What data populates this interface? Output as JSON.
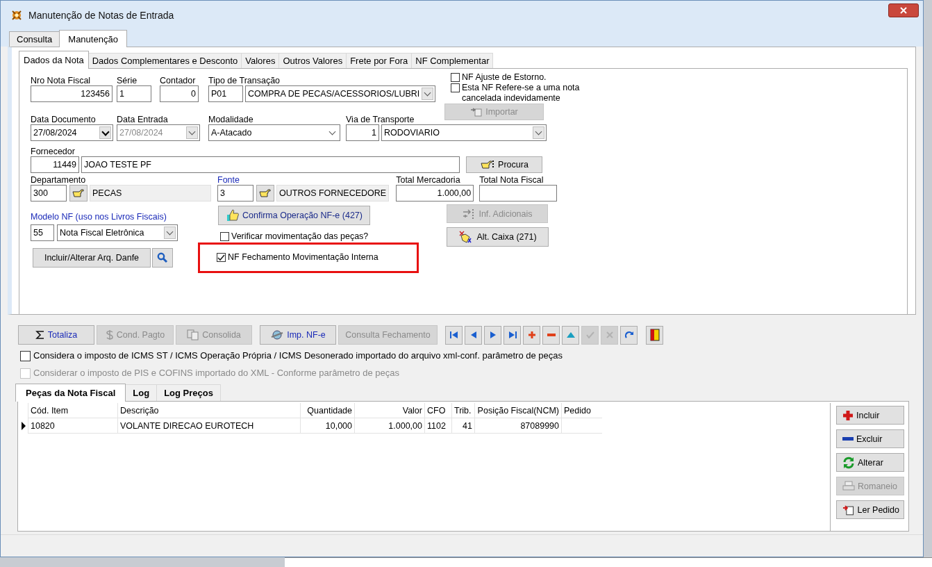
{
  "window": {
    "title": "Manutenção de Notas de Entrada"
  },
  "main_tabs": [
    {
      "label": "Consulta",
      "selected": false
    },
    {
      "label": "Manutenção",
      "selected": true
    }
  ],
  "sub_tabs": [
    {
      "label": "Dados da Nota",
      "selected": true
    },
    {
      "label": "Dados Complementares e Desconto",
      "selected": false
    },
    {
      "label": "Valores",
      "selected": false
    },
    {
      "label": "Outros Valores",
      "selected": false
    },
    {
      "label": "Frete por Fora",
      "selected": false
    },
    {
      "label": "NF Complementar",
      "selected": false
    }
  ],
  "form": {
    "nro_nota_fiscal": {
      "label": "Nro Nota Fiscal",
      "value": "123456"
    },
    "serie": {
      "label": "Série",
      "value": "1"
    },
    "contador": {
      "label": "Contador",
      "value": "0"
    },
    "tipo_transacao": {
      "label": "Tipo de Transação",
      "code": "P01",
      "value": "COMPRA DE PECAS/ACESSORIOS/LUBRI"
    },
    "nf_ajuste": {
      "label": "NF Ajuste  de Estorno.",
      "checked": false
    },
    "nf_refere": {
      "label": "Esta NF Refere-se a uma nota cancelada indevidamente",
      "checked": false
    },
    "importar": {
      "label": "Importar",
      "disabled": true
    },
    "data_documento": {
      "label": "Data Documento",
      "value": "27/08/2024",
      "disabled": false
    },
    "data_entrada": {
      "label": "Data Entrada",
      "value": "27/08/2024",
      "disabled": true
    },
    "modalidade": {
      "label": "Modalidade",
      "value": "A-Atacado"
    },
    "via_transporte": {
      "label": "Via de Transporte",
      "code": "1",
      "value": "RODOVIARIO"
    },
    "fornecedor": {
      "label": "Fornecedor",
      "code": "11449",
      "value": "JOAO TESTE PF"
    },
    "procura": {
      "label": "Procura"
    },
    "departamento": {
      "label": "Departamento",
      "code": "300",
      "value": "PECAS"
    },
    "fonte": {
      "label": "Fonte",
      "code": "3",
      "value": "OUTROS FORNECEDORE"
    },
    "total_mercadoria": {
      "label": "Total Mercadoria",
      "value": "1.000,00"
    },
    "total_nota_fiscal": {
      "label": "Total Nota Fiscal"
    },
    "modelo_nf": {
      "label": "Modelo NF (uso nos Livros Fiscais)",
      "code": "55",
      "value": "Nota Fiscal Eletrônica"
    },
    "confirma": {
      "label": "Confirma Operação NF-e (427)"
    },
    "inf_adicionais": {
      "label": "Inf. Adicionais",
      "disabled": true
    },
    "alt_caixa": {
      "label": "Alt. Caixa (271)"
    },
    "verificar": {
      "label": "Verificar movimentação das peças?",
      "checked": false
    },
    "nf_fechamento": {
      "label": "NF Fechamento Movimentação Interna",
      "checked": true
    },
    "danfe": {
      "label": "Incluir/Alterar Arq. Danfe"
    }
  },
  "toolbar": [
    {
      "label": "Totaliza",
      "kind": "sum",
      "disabled": false
    },
    {
      "label": "Cond. Pagto",
      "kind": "dollar",
      "disabled": true
    },
    {
      "label": "Consolida",
      "kind": "doc",
      "disabled": true
    },
    {
      "label": "Imp. NF-e",
      "kind": "globe",
      "disabled": false
    },
    {
      "label": "Consulta Fechamento",
      "kind": "plain",
      "disabled": true
    }
  ],
  "navigator": [
    {
      "kind": "first",
      "disabled": false
    },
    {
      "kind": "prior",
      "disabled": false
    },
    {
      "kind": "next",
      "disabled": false
    },
    {
      "kind": "last",
      "disabled": false
    },
    {
      "kind": "insert",
      "disabled": false
    },
    {
      "kind": "delete",
      "disabled": false
    },
    {
      "kind": "edit",
      "disabled": false
    },
    {
      "kind": "post",
      "disabled": true
    },
    {
      "kind": "cancel",
      "disabled": true
    },
    {
      "kind": "refresh",
      "disabled": false
    },
    {
      "kind": "exit",
      "disabled": false
    }
  ],
  "options": [
    {
      "label": "Considera o imposto de ICMS ST / ICMS Operação Própria / ICMS Desonerado importado do arquivo xml-conf. parâmetro de peças",
      "checked": false,
      "disabled": false
    },
    {
      "label": "Considerar o imposto de PIS e COFINS importado do XML - Conforme parâmetro de peças",
      "checked": false,
      "disabled": true
    }
  ],
  "lower_tabs": [
    {
      "label": "Peças da Nota Fiscal",
      "selected": true
    },
    {
      "label": "Log",
      "selected": false
    },
    {
      "label": "Log Preços",
      "selected": false
    }
  ],
  "table": {
    "columns": [
      "Cód. Item",
      "Descrição",
      "Quantidade",
      "Valor",
      "CFO",
      "Trib.",
      "Posição Fiscal(NCM)",
      "Pedido"
    ],
    "rows": [
      {
        "current": true,
        "cells": [
          "10820",
          "VOLANTE DIRECAO EUROTECH",
          "10,000",
          "1.000,00",
          "1102",
          "41",
          "87089990",
          ""
        ]
      }
    ]
  },
  "side_buttons": [
    {
      "label": "Incluir",
      "kind": "add",
      "disabled": false
    },
    {
      "label": "Excluir",
      "kind": "remove",
      "disabled": false
    },
    {
      "label": "Alterar",
      "kind": "refresh",
      "disabled": false
    },
    {
      "label": "Romaneio",
      "kind": "print",
      "disabled": true
    },
    {
      "label": "Ler Pedido",
      "kind": "import",
      "disabled": false
    }
  ]
}
